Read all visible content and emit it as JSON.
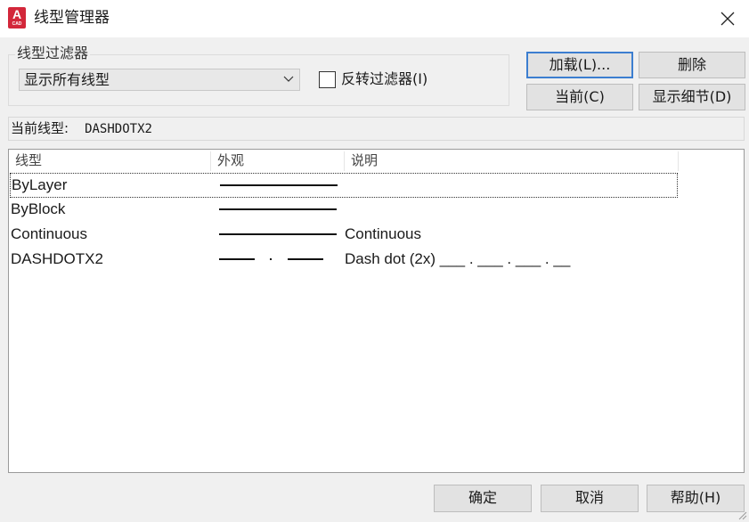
{
  "window": {
    "title": "线型管理器",
    "icon": {
      "letter": "A",
      "tag": "CAD",
      "color": "#d3273a"
    }
  },
  "filter": {
    "group_label": "线型过滤器",
    "selected": "显示所有线型",
    "invert_label": "反转过滤器(I)",
    "invert_checked": false
  },
  "buttons": {
    "load": "加载(L)...",
    "delete": "删除",
    "current": "当前(C)",
    "details": "显示细节(D)",
    "ok": "确定",
    "cancel": "取消",
    "help": "帮助(H)"
  },
  "current_linetype": {
    "label": "当前线型:",
    "value": "DASHDOTX2"
  },
  "table": {
    "columns": [
      "线型",
      "外观",
      "说明"
    ],
    "rows": [
      {
        "name": "ByLayer",
        "appearance": "solid",
        "description": ""
      },
      {
        "name": "ByBlock",
        "appearance": "solid",
        "description": ""
      },
      {
        "name": "Continuous",
        "appearance": "solid",
        "description": "Continuous"
      },
      {
        "name": "DASHDOTX2",
        "appearance": "dash-dot",
        "description": "Dash dot (2x) ___ . ___ . ___ . __"
      }
    ],
    "focused_row": 0
  },
  "colors": {
    "accent": "#3c7ed0"
  }
}
